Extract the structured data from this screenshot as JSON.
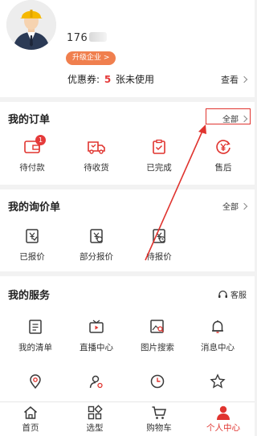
{
  "profile": {
    "phone_prefix": "176",
    "upgrade_label": "升级企业 >",
    "coupon_prefix": "优惠券: ",
    "coupon_count": "5",
    "coupon_suffix": " 张未使用",
    "coupon_view": "查看"
  },
  "orders": {
    "title": "我的订单",
    "all_label": "全部",
    "items": [
      {
        "label": "待付款",
        "icon": "wallet-icon",
        "badge": "1"
      },
      {
        "label": "待收货",
        "icon": "truck-icon"
      },
      {
        "label": "已完成",
        "icon": "clipboard-check-icon"
      },
      {
        "label": "售后",
        "icon": "yen-return-icon"
      }
    ]
  },
  "inquiry": {
    "title": "我的询价单",
    "all_label": "全部",
    "items": [
      {
        "label": "已报价",
        "icon": "quoted-icon"
      },
      {
        "label": "部分报价",
        "icon": "partial-quote-icon"
      },
      {
        "label": "待报价",
        "icon": "pending-quote-icon"
      }
    ]
  },
  "services": {
    "title": "我的服务",
    "support_label": "客服",
    "items": [
      {
        "label": "我的清单",
        "icon": "list-icon"
      },
      {
        "label": "直播中心",
        "icon": "live-tv-icon"
      },
      {
        "label": "图片搜索",
        "icon": "image-search-icon"
      },
      {
        "label": "消息中心",
        "icon": "bell-icon"
      },
      {
        "label": "",
        "icon": "location-user-icon"
      },
      {
        "label": "",
        "icon": "user-settings-icon"
      },
      {
        "label": "",
        "icon": "clock-icon"
      },
      {
        "label": "",
        "icon": "star-icon"
      }
    ]
  },
  "tabbar": {
    "items": [
      {
        "label": "首页",
        "icon": "home-icon"
      },
      {
        "label": "选型",
        "icon": "grid-icon"
      },
      {
        "label": "购物车",
        "icon": "cart-icon"
      },
      {
        "label": "个人中心",
        "icon": "person-icon",
        "active": true
      }
    ]
  },
  "colors": {
    "accent": "#e0342f",
    "badge": "#e53a3a",
    "upgrade": "#f07f4e",
    "icon_gray": "#3a3a3a"
  }
}
